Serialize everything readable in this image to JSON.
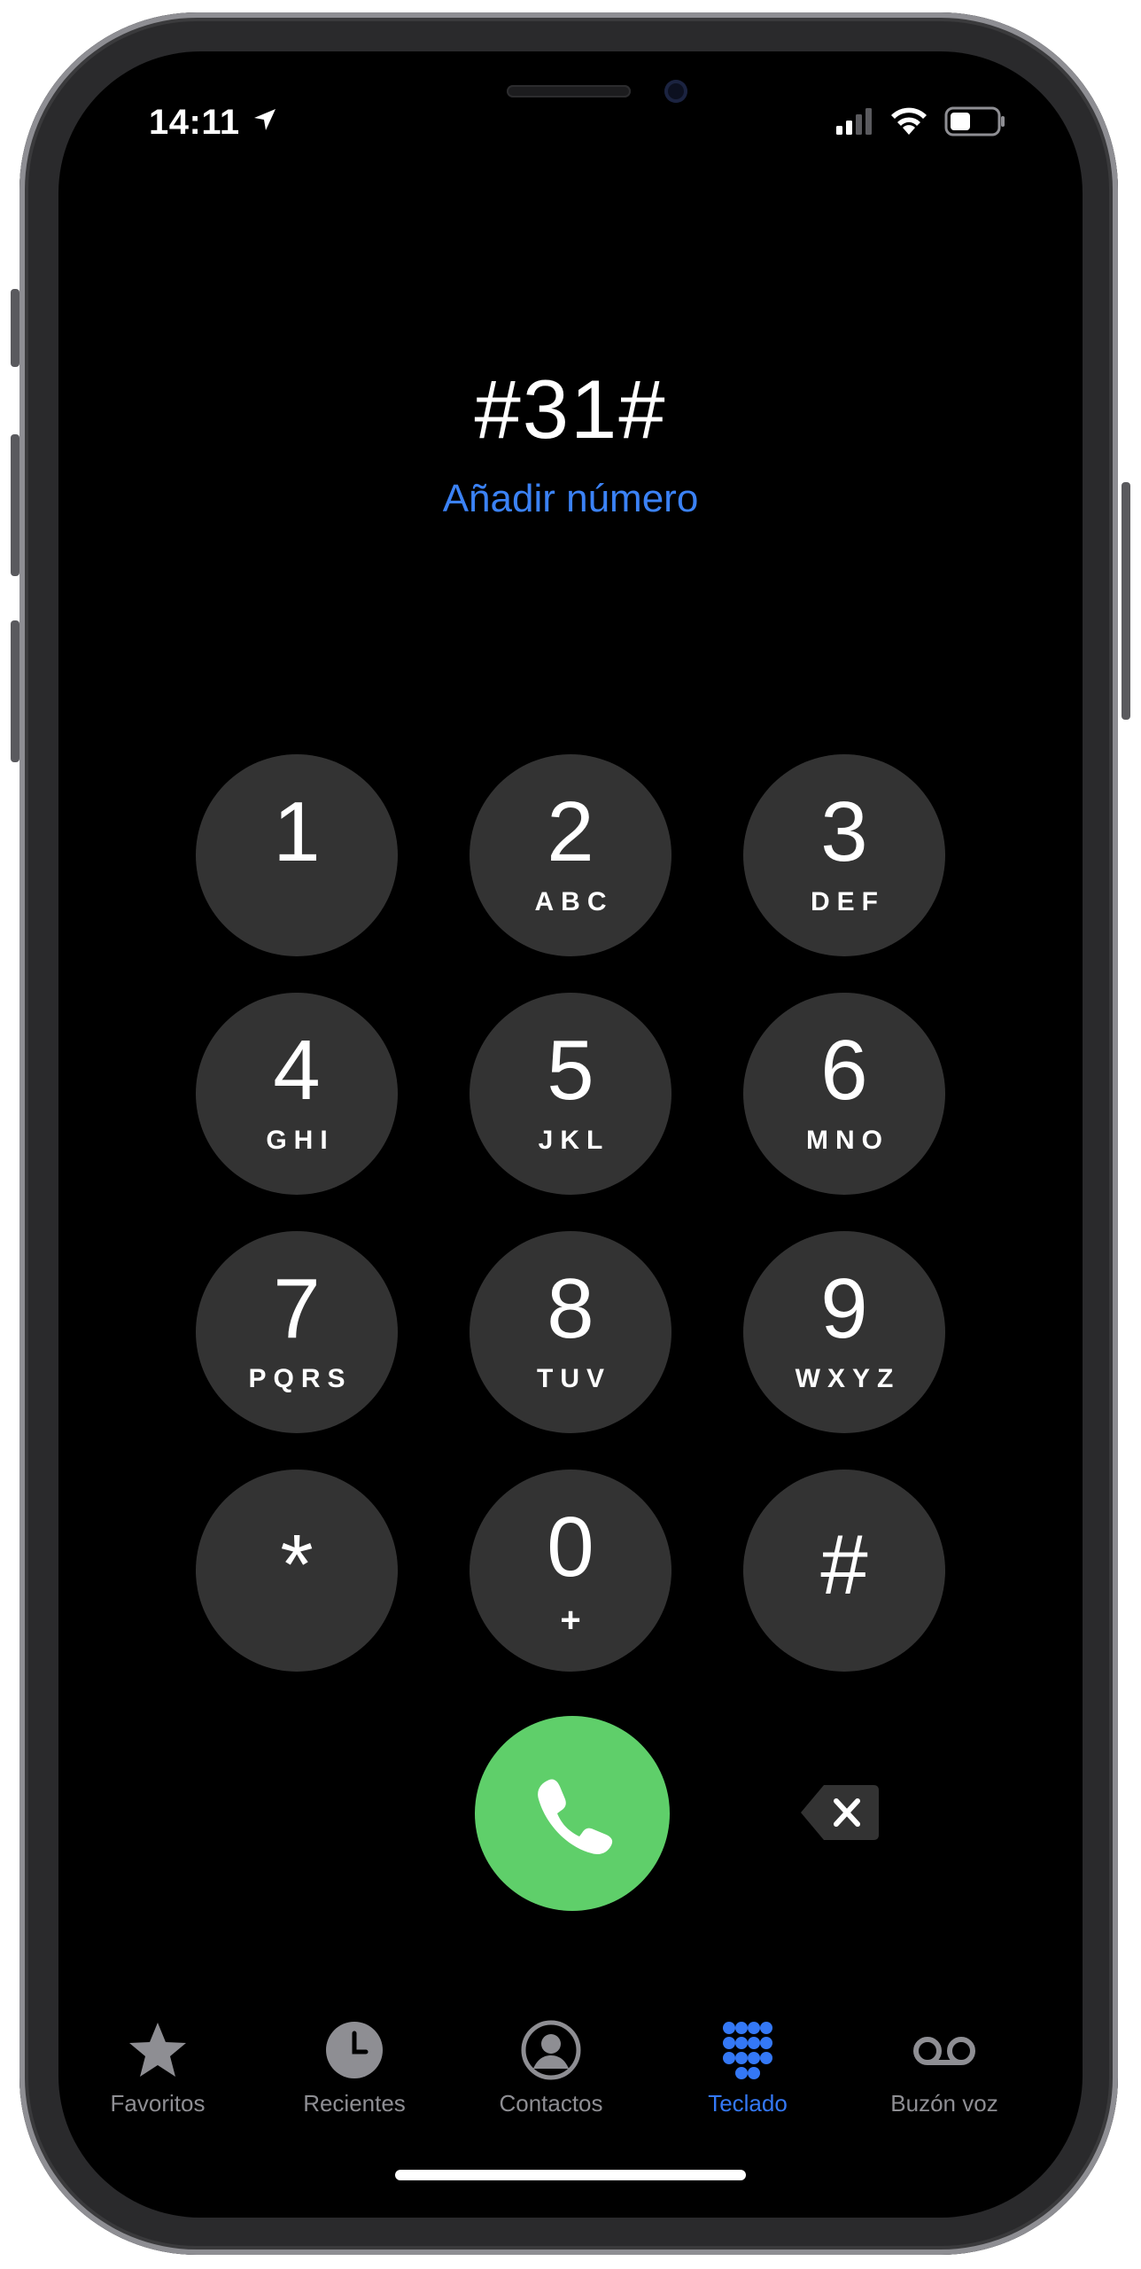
{
  "status_bar": {
    "time": "14:11"
  },
  "dialer": {
    "number": "#31#",
    "add_number": "Añadir número"
  },
  "keypad": [
    {
      "digit": "1",
      "letters": ""
    },
    {
      "digit": "2",
      "letters": "ABC"
    },
    {
      "digit": "3",
      "letters": "DEF"
    },
    {
      "digit": "4",
      "letters": "GHI"
    },
    {
      "digit": "5",
      "letters": "JKL"
    },
    {
      "digit": "6",
      "letters": "MNO"
    },
    {
      "digit": "7",
      "letters": "PQRS"
    },
    {
      "digit": "8",
      "letters": "TUV"
    },
    {
      "digit": "9",
      "letters": "WXYZ"
    },
    {
      "digit": "*",
      "letters": ""
    },
    {
      "digit": "0",
      "letters": "+"
    },
    {
      "digit": "#",
      "letters": ""
    }
  ],
  "tabs": [
    {
      "label": "Favoritos",
      "icon": "star-icon",
      "active": false
    },
    {
      "label": "Recientes",
      "icon": "clock-icon",
      "active": false
    },
    {
      "label": "Contactos",
      "icon": "contact-icon",
      "active": false
    },
    {
      "label": "Teclado",
      "icon": "keypad-icon",
      "active": true
    },
    {
      "label": "Buzón voz",
      "icon": "voicemail-icon",
      "active": false
    }
  ],
  "colors": {
    "accent": "#3478f6",
    "call_green": "#5fcf6a",
    "key_bg": "#333333"
  }
}
